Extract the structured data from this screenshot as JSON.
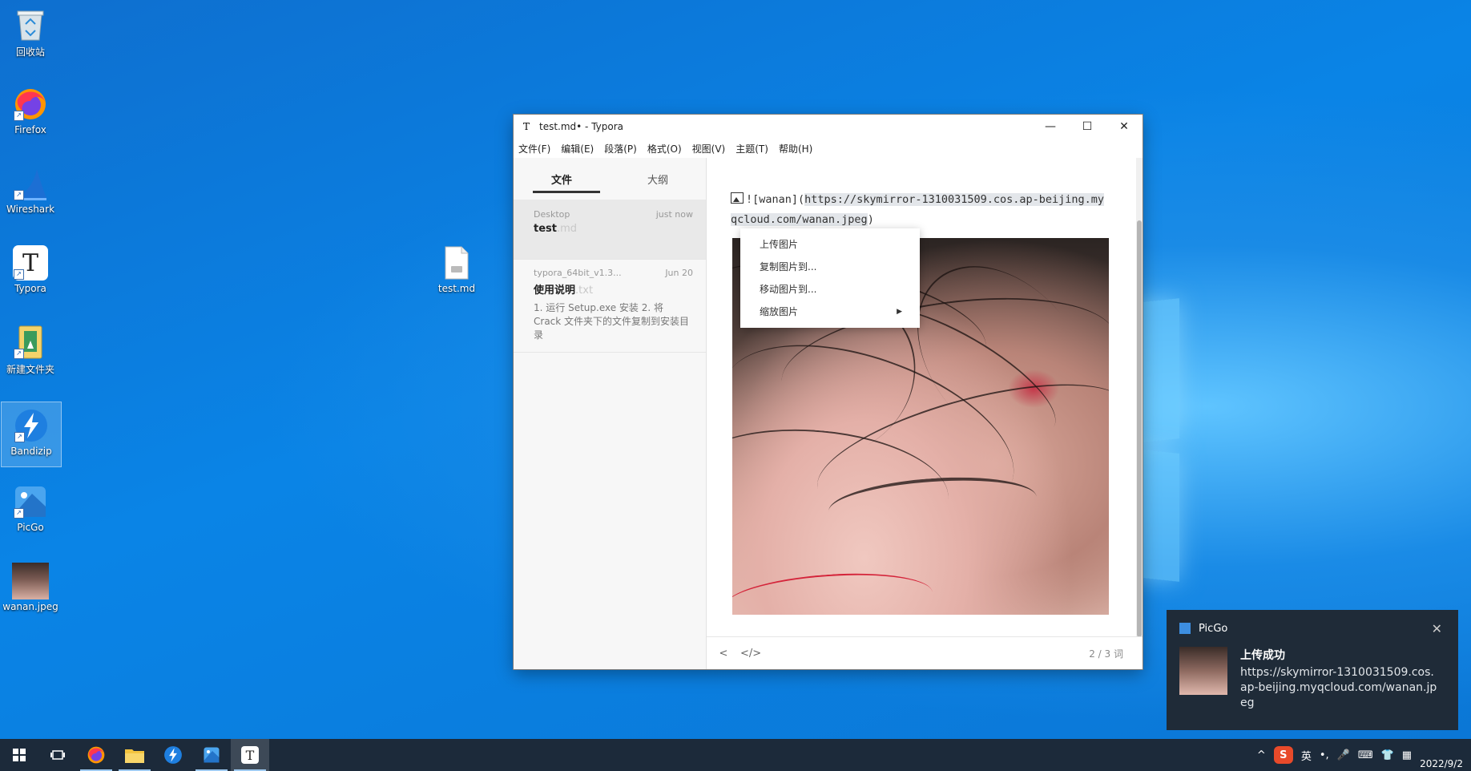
{
  "desktop": {
    "icons": [
      {
        "label": "回收站",
        "icon": "recycle-bin-icon"
      },
      {
        "label": "Firefox",
        "icon": "firefox-icon"
      },
      {
        "label": "Wireshark",
        "icon": "wireshark-icon"
      },
      {
        "label": "Typora",
        "icon": "typora-icon"
      },
      {
        "label": "新建文件夹",
        "icon": "folder-icon"
      },
      {
        "label": "Bandizip",
        "icon": "bandizip-icon"
      },
      {
        "label": "PicGo",
        "icon": "picgo-icon"
      },
      {
        "label": "wanan.jpeg",
        "icon": "image-file-icon"
      },
      {
        "label": "test.md",
        "icon": "markdown-file-icon"
      }
    ]
  },
  "typora": {
    "title": "test.md• - Typora",
    "logo": "T",
    "controls": {
      "minimize": "—",
      "maximize": "☐",
      "close": "✕"
    },
    "menu": [
      "文件(F)",
      "编辑(E)",
      "段落(P)",
      "格式(O)",
      "视图(V)",
      "主题(T)",
      "帮助(H)"
    ],
    "sidebar": {
      "tabs": [
        "文件",
        "大纲"
      ],
      "active_tab": "文件",
      "files": [
        {
          "folder": "Desktop",
          "time": "just now",
          "name": "test",
          "ext": ".md",
          "excerpt": ""
        },
        {
          "folder": "typora_64bit_v1.3...",
          "time": "Jun 20",
          "name": "使用说明",
          "ext": ".txt",
          "excerpt": "1. 运行 Setup.exe 安装 2. 将 Crack 文件夹下的文件复制到安装目录"
        }
      ]
    },
    "editor": {
      "md_prefix": "![wanan](",
      "md_url": "https://skymirror-1310031509.cos.ap-beijing.myqcloud.com/wanan.jpeg",
      "md_suffix": ")"
    },
    "context_menu": [
      "上传图片",
      "复制图片到...",
      "移动图片到...",
      "缩放图片"
    ],
    "status": {
      "word_count": "2 / 3 词",
      "back": "<",
      "source": "</>"
    }
  },
  "toast": {
    "app": "PicGo",
    "title": "上传成功",
    "message": "https://skymirror-1310031509.cos.ap-beijing.myqcloud.com/wanan.jpeg",
    "close": "✕"
  },
  "taskbar": {
    "items": [
      "start-icon",
      "task-view-icon",
      "firefox-icon",
      "file-explorer-icon",
      "bandizip-icon",
      "picgo-icon",
      "typora-icon"
    ],
    "tray": {
      "ime": "英",
      "date": "2022/9/2"
    }
  }
}
